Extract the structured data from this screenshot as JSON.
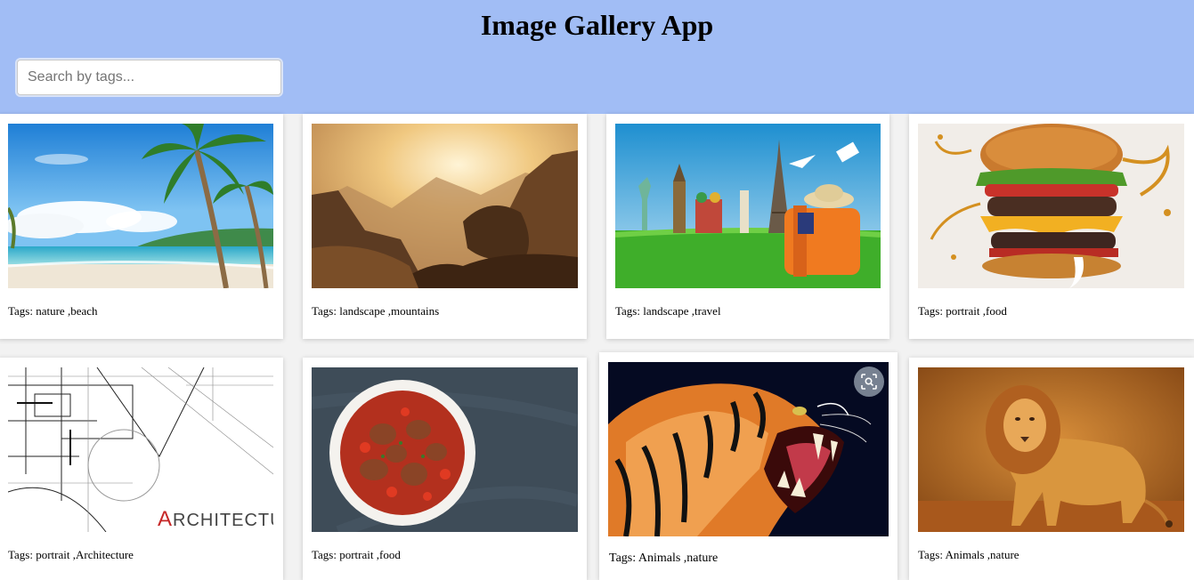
{
  "header": {
    "title": "Image Gallery App",
    "background": "#a1bdf5"
  },
  "search": {
    "placeholder": "Search by tags...",
    "value": ""
  },
  "gallery": {
    "cards": [
      {
        "tags_text": "Tags: nature ,beach",
        "image": "beach-palm-trees"
      },
      {
        "tags_text": "Tags: landscape ,mountains",
        "image": "sunlit-mountains"
      },
      {
        "tags_text": "Tags: landscape ,travel",
        "image": "world-landmarks-suitcase"
      },
      {
        "tags_text": "Tags: portrait ,food",
        "image": "burger-splash"
      },
      {
        "tags_text": "Tags: portrait ,Architecture",
        "image": "architecture-blueprint",
        "image_text": "Architecture"
      },
      {
        "tags_text": "Tags: portrait ,food",
        "image": "stew-bowl"
      },
      {
        "tags_text": "Tags: Animals ,nature",
        "image": "roaring-tiger",
        "hover_icon": "visual-search-icon"
      },
      {
        "tags_text": "Tags: Animals ,nature",
        "image": "walking-lion"
      }
    ]
  }
}
